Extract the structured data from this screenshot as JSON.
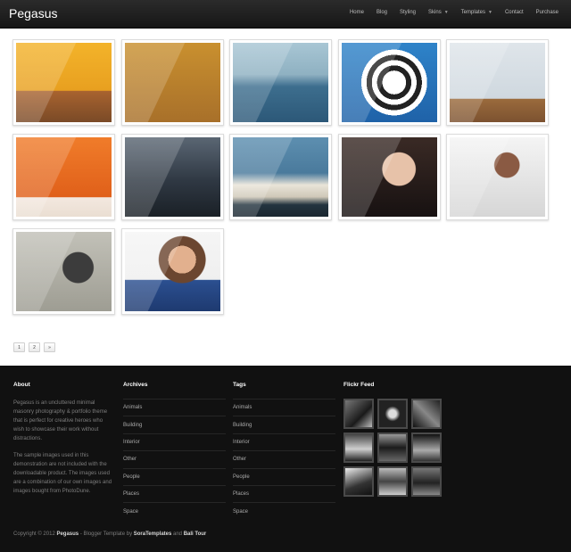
{
  "header": {
    "logo": "Pegasus",
    "nav": [
      {
        "label": "Home",
        "caret": false
      },
      {
        "label": "Blog",
        "caret": false
      },
      {
        "label": "Styling",
        "caret": false
      },
      {
        "label": "Skins",
        "caret": true
      },
      {
        "label": "Templates",
        "caret": true
      },
      {
        "label": "Contact",
        "caret": false
      },
      {
        "label": "Purchase",
        "caret": false
      }
    ]
  },
  "gallery": {
    "photos": [
      "yellow-room-chairs-photo",
      "zebra-photo",
      "heron-photo",
      "umbrella-photo",
      "yellow-armchair-photo",
      "orange-room-chair-photo",
      "dark-field-photo",
      "shuttle-launch-photo",
      "woman-veil-photo",
      "woman-white-shirt-photo",
      "woman-cap-sitting-photo",
      "smiling-woman-photo"
    ]
  },
  "pagination": {
    "pages": [
      "1",
      "2"
    ],
    "next": "»"
  },
  "footer": {
    "about": {
      "title": "About",
      "p1": "Pegasus is an uncluttered minimal masonry photography & portfolio theme that is perfect for creative heroes who wish to showcase their work without distractions.",
      "p2": "The sample images used in this demonstration are not included with the downloadable product. The images used are a combination of our own images and images bought from PhotoDune."
    },
    "archives": {
      "title": "Archives",
      "items": [
        "Animals",
        "Building",
        "Interior",
        "Other",
        "People",
        "Places",
        "Space"
      ]
    },
    "tags": {
      "title": "Tags",
      "items": [
        "Animals",
        "Building",
        "Interior",
        "Other",
        "People",
        "Places",
        "Space"
      ]
    },
    "flickr": {
      "title": "Flickr Feed"
    },
    "copyright": {
      "prefix": "Copyright © 2012",
      "brand": "Pegasus",
      "mid": "- Blogger Template by",
      "author": "SoraTemplates",
      "and": "and",
      "partner": "Bali Tour"
    }
  },
  "colors": {
    "header_bg": "#1c1c1c",
    "footer_bg": "#111111",
    "page_bg": "#ffffff"
  }
}
